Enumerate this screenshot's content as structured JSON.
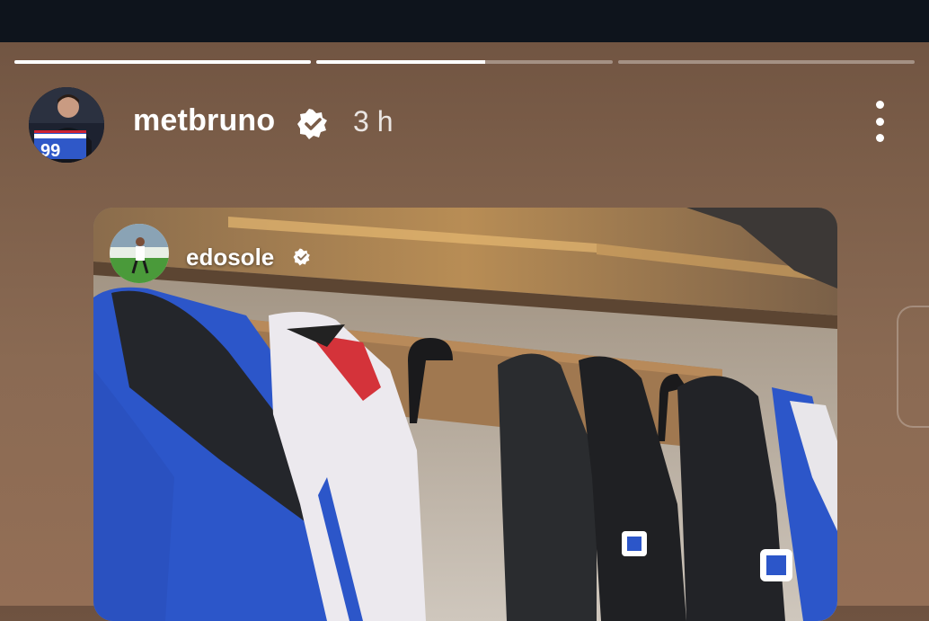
{
  "story": {
    "segments": [
      {
        "progress": 1.0
      },
      {
        "progress": 0.57
      },
      {
        "progress": 0.0
      }
    ],
    "author": {
      "username": "metbruno",
      "verified": true,
      "time": "3 h",
      "avatar_icon": "profile-photo-icon"
    },
    "more_icon": "more-vertical-icon",
    "reshared_post": {
      "username": "edosole",
      "verified": true,
      "avatar_icon": "profile-photo-icon",
      "media": "locker-room-photo"
    }
  },
  "colors": {
    "status_bar": "#0e141c",
    "background": "#7d5f4a",
    "verified_badge": "#ffffff",
    "jersey_blue": "#2c56c9"
  }
}
